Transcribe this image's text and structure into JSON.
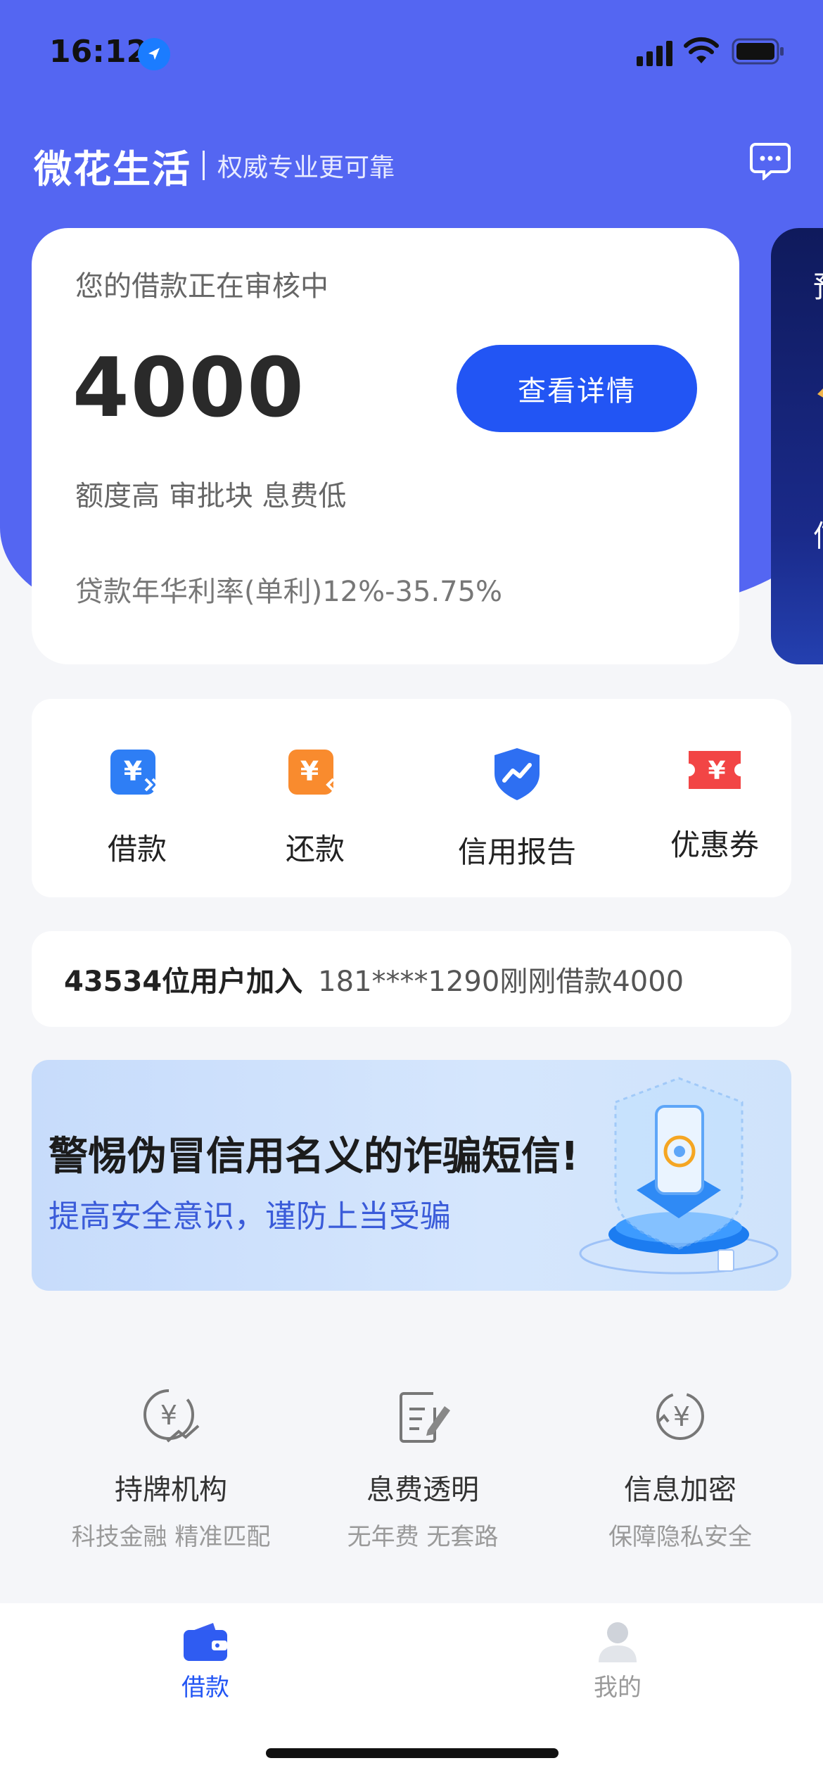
{
  "status_bar": {
    "time": "16:12"
  },
  "header": {
    "brand": "微花生活",
    "slogan": "权威专业更可靠"
  },
  "loan_card": {
    "status": "您的借款正在审核中",
    "amount": "4000",
    "detail_button": "查看详情",
    "tags": "额度高 审批块 息费低",
    "rate": "贷款年华利率(单利)12%-35.75%"
  },
  "side_card": {
    "glyph_top": "预",
    "glyph_bottom": "信"
  },
  "shortcuts": [
    {
      "label": "借款",
      "icon": "borrow-icon"
    },
    {
      "label": "还款",
      "icon": "repay-icon"
    },
    {
      "label": "信用报告",
      "icon": "credit-report-icon"
    },
    {
      "label": "优惠券",
      "icon": "coupon-icon"
    }
  ],
  "ticker": {
    "count": "43534位用户加入",
    "message": "181****1290刚刚借款4000"
  },
  "banner": {
    "title": "警惕伪冒信用名义的诈骗短信!",
    "subtitle": "提高安全意识，谨防上当受骗"
  },
  "features": [
    {
      "title": "持牌机构",
      "desc": "科技金融 精准匹配",
      "icon": "licensed-icon"
    },
    {
      "title": "息费透明",
      "desc": "无年费 无套路",
      "icon": "document-edit-icon"
    },
    {
      "title": "信息加密",
      "desc": "保障隐私安全",
      "icon": "encrypt-icon"
    }
  ],
  "tab_bar": {
    "tabs": [
      {
        "label": "借款",
        "icon": "wallet-icon",
        "active": true
      },
      {
        "label": "我的",
        "icon": "user-icon",
        "active": false
      }
    ]
  },
  "colors": {
    "primary": "#2255f4",
    "hero": "#5466f2",
    "background": "#f5f6f9"
  }
}
